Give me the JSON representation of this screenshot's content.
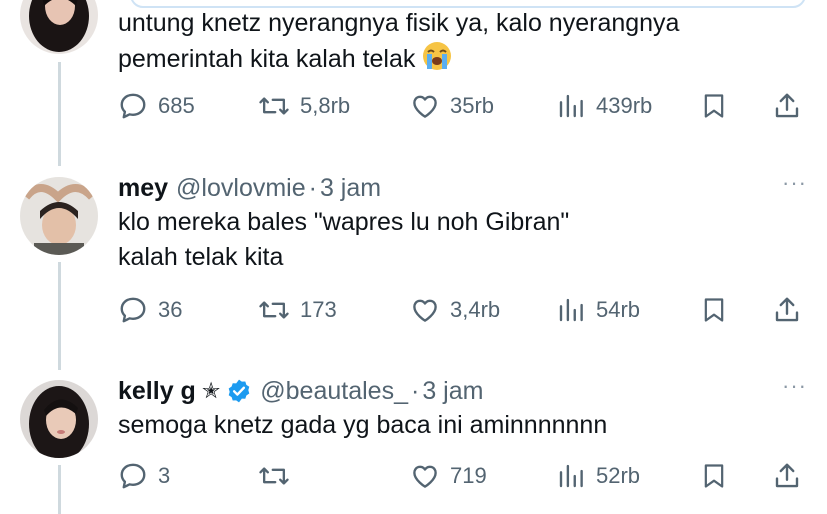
{
  "tweets": [
    {
      "text_lines": [
        "untung knetz nyerangnya fisik ya, kalo nyerangnya",
        "pemerintah kita kalah telak"
      ],
      "emoji": "loudly-crying-face",
      "replies": "685",
      "reposts": "5,8rb",
      "likes": "35rb",
      "views": "439rb"
    },
    {
      "name": "mey",
      "handle": "@lovlovmie",
      "separator": "·",
      "time": "3 jam",
      "more": "···",
      "text_lines": [
        "klo mereka bales \"wapres lu noh Gibran\"",
        "kalah telak kita"
      ],
      "replies": "36",
      "reposts": "173",
      "likes": "3,4rb",
      "views": "54rb"
    },
    {
      "name": "kelly g",
      "badge": "✭",
      "verified": true,
      "handle": "@beautales_",
      "separator": "·",
      "time": "3 jam",
      "more": "···",
      "text_lines": [
        "semoga knetz gada yg baca ini aminnnnnnn"
      ],
      "replies": "3",
      "reposts": "",
      "likes": "719",
      "views": "52rb"
    }
  ],
  "icons": [
    "reply-icon",
    "repost-icon",
    "like-icon",
    "views-icon",
    "bookmark-icon",
    "share-icon"
  ],
  "colors": {
    "text": "#0f1419",
    "muted": "#536471",
    "verified": "#1d9bf0",
    "thread": "#cfd9de"
  }
}
